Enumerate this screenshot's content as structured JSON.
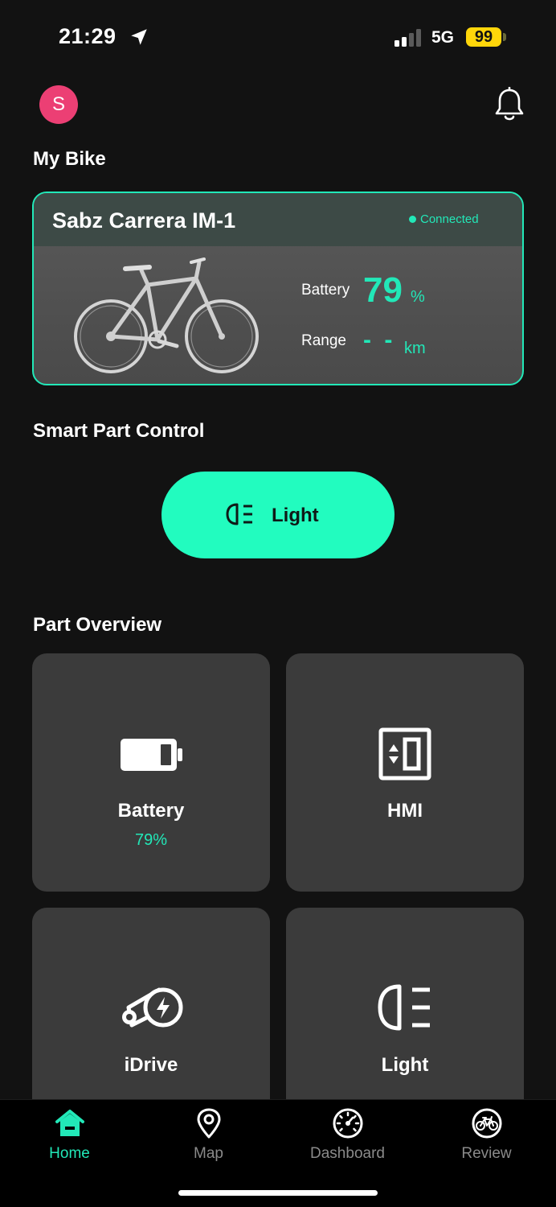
{
  "status_bar": {
    "time": "21:29",
    "network": "5G",
    "battery": "99",
    "battery_color": "#ffd60a"
  },
  "header": {
    "avatar_initial": "S",
    "avatar_color": "#ec3f74"
  },
  "my_bike": {
    "section_title": "My Bike",
    "bike_name": "Sabz Carrera IM-1",
    "connection_status": "Connected",
    "battery_label": "Battery",
    "battery_value": "79",
    "battery_unit": "%",
    "range_label": "Range",
    "range_value": "- -",
    "range_unit": "km"
  },
  "smart_part_control": {
    "section_title": "Smart Part Control",
    "light_button_label": "Light"
  },
  "part_overview": {
    "section_title": "Part Overview",
    "tiles": [
      {
        "label": "Battery",
        "sub": "79%",
        "icon": "battery-icon"
      },
      {
        "label": "HMI",
        "sub": "",
        "icon": "hmi-display-icon"
      },
      {
        "label": "iDrive",
        "sub": "",
        "icon": "idrive-motor-icon"
      },
      {
        "label": "Light",
        "sub": "",
        "icon": "headlight-icon"
      }
    ]
  },
  "tab_bar": {
    "tabs": [
      {
        "label": "Home",
        "icon": "home-icon",
        "active": true
      },
      {
        "label": "Map",
        "icon": "map-pin-icon",
        "active": false
      },
      {
        "label": "Dashboard",
        "icon": "speedometer-icon",
        "active": false
      },
      {
        "label": "Review",
        "icon": "bike-review-icon",
        "active": false
      }
    ]
  },
  "colors": {
    "accent": "#22e8b8",
    "button_accent": "#22fcbf",
    "background": "#121212",
    "tile_background": "#3b3b3b"
  }
}
